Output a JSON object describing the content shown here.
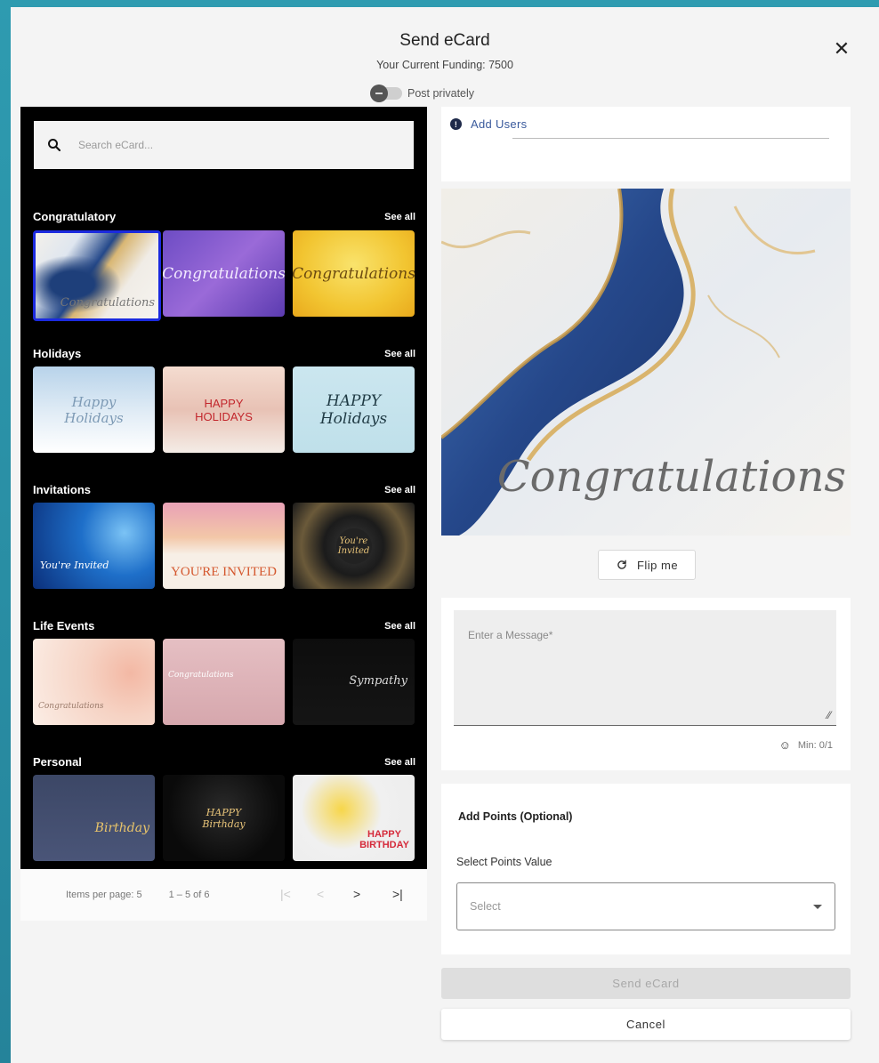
{
  "dialog": {
    "title": "Send eCard",
    "funding": "Your Current Funding: 7500",
    "privacy_label": "Post privately",
    "close_glyph": "✕"
  },
  "search": {
    "placeholder": "Search eCard..."
  },
  "categories": [
    {
      "title": "Congratulatory",
      "see_all": "See all",
      "cards": [
        {
          "text": "Congratulations",
          "theme": "blue-gold-marble",
          "selected": true
        },
        {
          "text": "Congratulations",
          "theme": "purple-watercolor"
        },
        {
          "text": "Congratulations",
          "theme": "yellow-watercolor"
        }
      ]
    },
    {
      "title": "Holidays",
      "see_all": "See all",
      "cards": [
        {
          "text": "Happy Holidays",
          "theme": "snowy-forest"
        },
        {
          "text": "HAPPY HOLIDAYS",
          "theme": "ornaments"
        },
        {
          "text": "HAPPY Holidays",
          "theme": "light-blue"
        }
      ]
    },
    {
      "title": "Invitations",
      "see_all": "See all",
      "cards": [
        {
          "text": "You're Invited",
          "theme": "blue-bokeh"
        },
        {
          "text": "YOU'RE INVITED",
          "theme": "balloons"
        },
        {
          "text": "You're Invited",
          "theme": "gold-stars"
        }
      ]
    },
    {
      "title": "Life Events",
      "see_all": "See all",
      "cards": [
        {
          "text": "Congratulations",
          "theme": "roses"
        },
        {
          "text": "Congratulations",
          "theme": "cake"
        },
        {
          "text": "Sympathy",
          "theme": "calla-lily"
        }
      ]
    },
    {
      "title": "Personal",
      "see_all": "See all",
      "cards": [
        {
          "text": "Birthday",
          "theme": "navy-gift"
        },
        {
          "text": "HAPPY Birthday",
          "theme": "gold-balloons"
        },
        {
          "text": "HAPPY BIRTHDAY",
          "theme": "emoji-party"
        }
      ]
    }
  ],
  "pagination": {
    "items_per_page": "Items per page: 5",
    "range": "1 – 5 of 6",
    "first": "|<",
    "prev": "<",
    "next": ">",
    "last": ">|"
  },
  "users": {
    "label": "Add Users",
    "info_icon": "info-icon"
  },
  "preview": {
    "text": "Congratulations"
  },
  "flip": {
    "label": "Flip me"
  },
  "message": {
    "placeholder": "Enter a Message*",
    "min_count": "Min: 0/1"
  },
  "points": {
    "title": "Add Points (Optional)",
    "select_label": "Select Points Value",
    "select_placeholder": "Select"
  },
  "actions": {
    "send": "Send eCard",
    "cancel": "Cancel"
  },
  "colors": {
    "accent_border": "#1b2adf",
    "background": "#f4f4f4",
    "page_bg": "#2a8fa3"
  }
}
